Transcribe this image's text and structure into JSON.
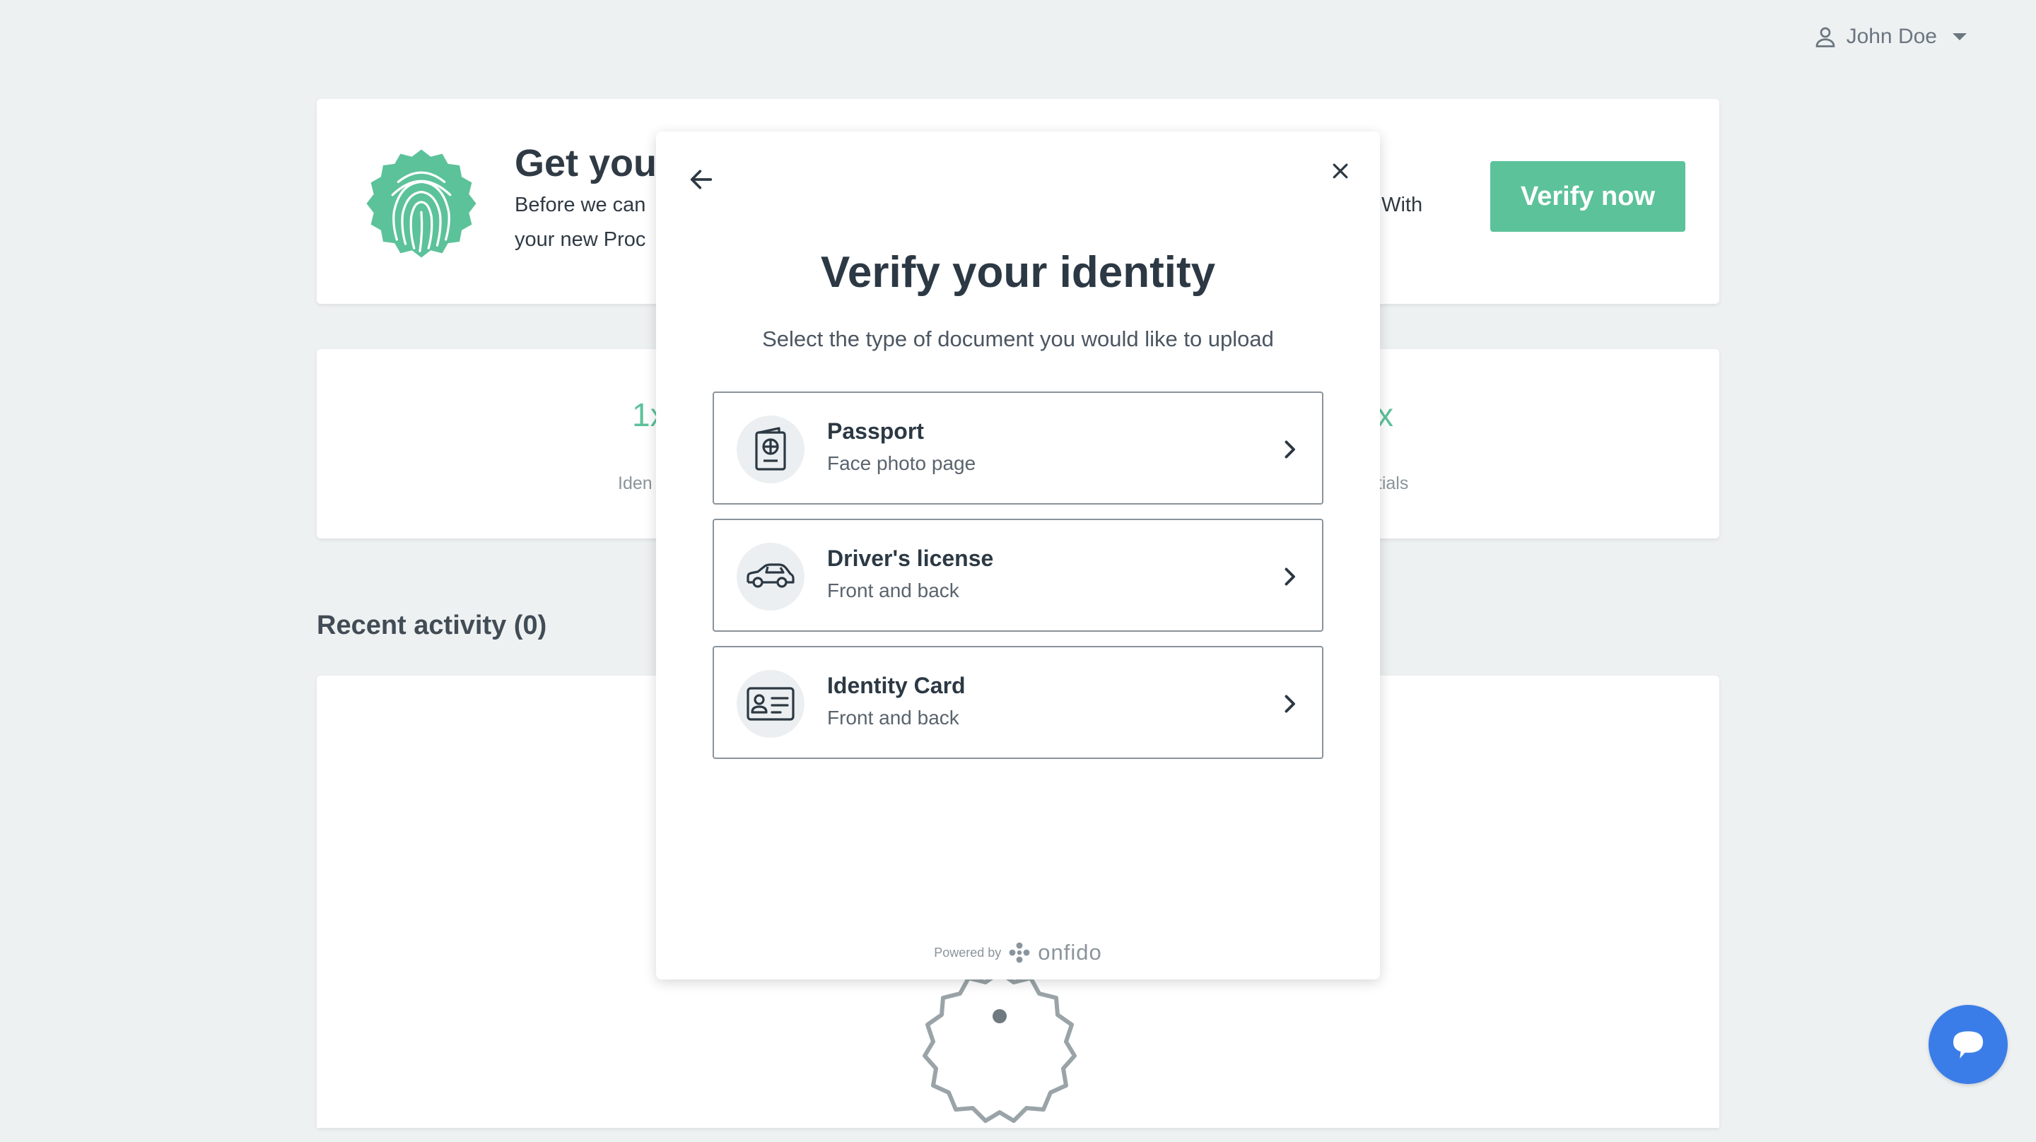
{
  "user_menu": {
    "name": "John Doe"
  },
  "banner": {
    "title": "Get you",
    "line1": "Before we can",
    "line1_tail": ". With",
    "line2": "your new Proc",
    "verify_button": "Verify now"
  },
  "stats": [
    {
      "value": "1x",
      "label": "Iden"
    },
    {
      "value": "x",
      "label": "etials"
    }
  ],
  "activity": {
    "title": "Recent activity (0)"
  },
  "modal": {
    "title": "Verify your identity",
    "subtitle": "Select the type of document you would like to upload",
    "options": [
      {
        "title": "Passport",
        "hint": "Face photo page",
        "icon": "passport-icon"
      },
      {
        "title": "Driver's license",
        "hint": "Front and back",
        "icon": "car-icon"
      },
      {
        "title": "Identity Card",
        "hint": "Front and back",
        "icon": "id-card-icon"
      }
    ],
    "powered_by": "Powered by",
    "brand": "onfido"
  },
  "colors": {
    "accent": "#5cc29a",
    "chat": "#3b7de8",
    "background": "#eef1f2"
  }
}
